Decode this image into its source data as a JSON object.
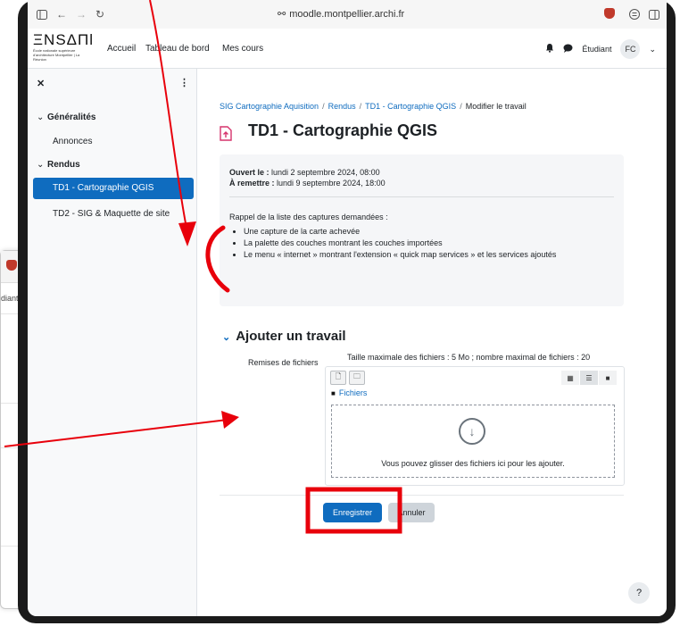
{
  "browser": {
    "url": "moodle.montpellier.archi.fr"
  },
  "navbar": {
    "logo_text": "ΞNSΔΠl",
    "logo_sub": "École nationale supérieure d'architecture Montpellier | La Réunion",
    "links": [
      "Accueil",
      "Tableau de bord",
      "Mes cours"
    ],
    "role": "Étudiant",
    "initials": "FC"
  },
  "drawer": {
    "section1": "Généralités",
    "section1_items": [
      "Annonces"
    ],
    "section2": "Rendus",
    "section2_items": [
      "TD1 - Cartographie QGIS",
      "TD2 - SIG & Maquette de site"
    ]
  },
  "breadcrumb": [
    "SIG Cartographie Aquisition",
    "Rendus",
    "TD1 - Cartographie QGIS",
    "Modifier le travail"
  ],
  "page_title": "TD1 - Cartographie QGIS",
  "info": {
    "opened_label": "Ouvert le :",
    "opened_value": " lundi 2 septembre 2024, 08:00",
    "due_label": "À remettre :",
    "due_value": " lundi 9 septembre 2024, 18:00",
    "intro": "Rappel de la liste des captures demandées :",
    "bullets": [
      "Une capture de la carte achevée",
      "La palette des couches montrant les couches importées",
      "Le menu « internet » montrant l'extension « quick map services » et les services ajoutés"
    ]
  },
  "form": {
    "section_title": "Ajouter un travail",
    "files_label": "Remises de fichiers",
    "limits": "Taille maximale des fichiers : 5 Mo ; nombre maximal de fichiers : 20",
    "folder": "Fichiers",
    "drop_text": "Vous pouvez glisser des fichiers ici pour les ajouter.",
    "save": "Enregistrer",
    "cancel": "Annuler"
  },
  "help": "?",
  "background_window": {
    "text": "diant"
  },
  "colors": {
    "primary": "#0f6cbf",
    "annotation": "#e8000b"
  }
}
